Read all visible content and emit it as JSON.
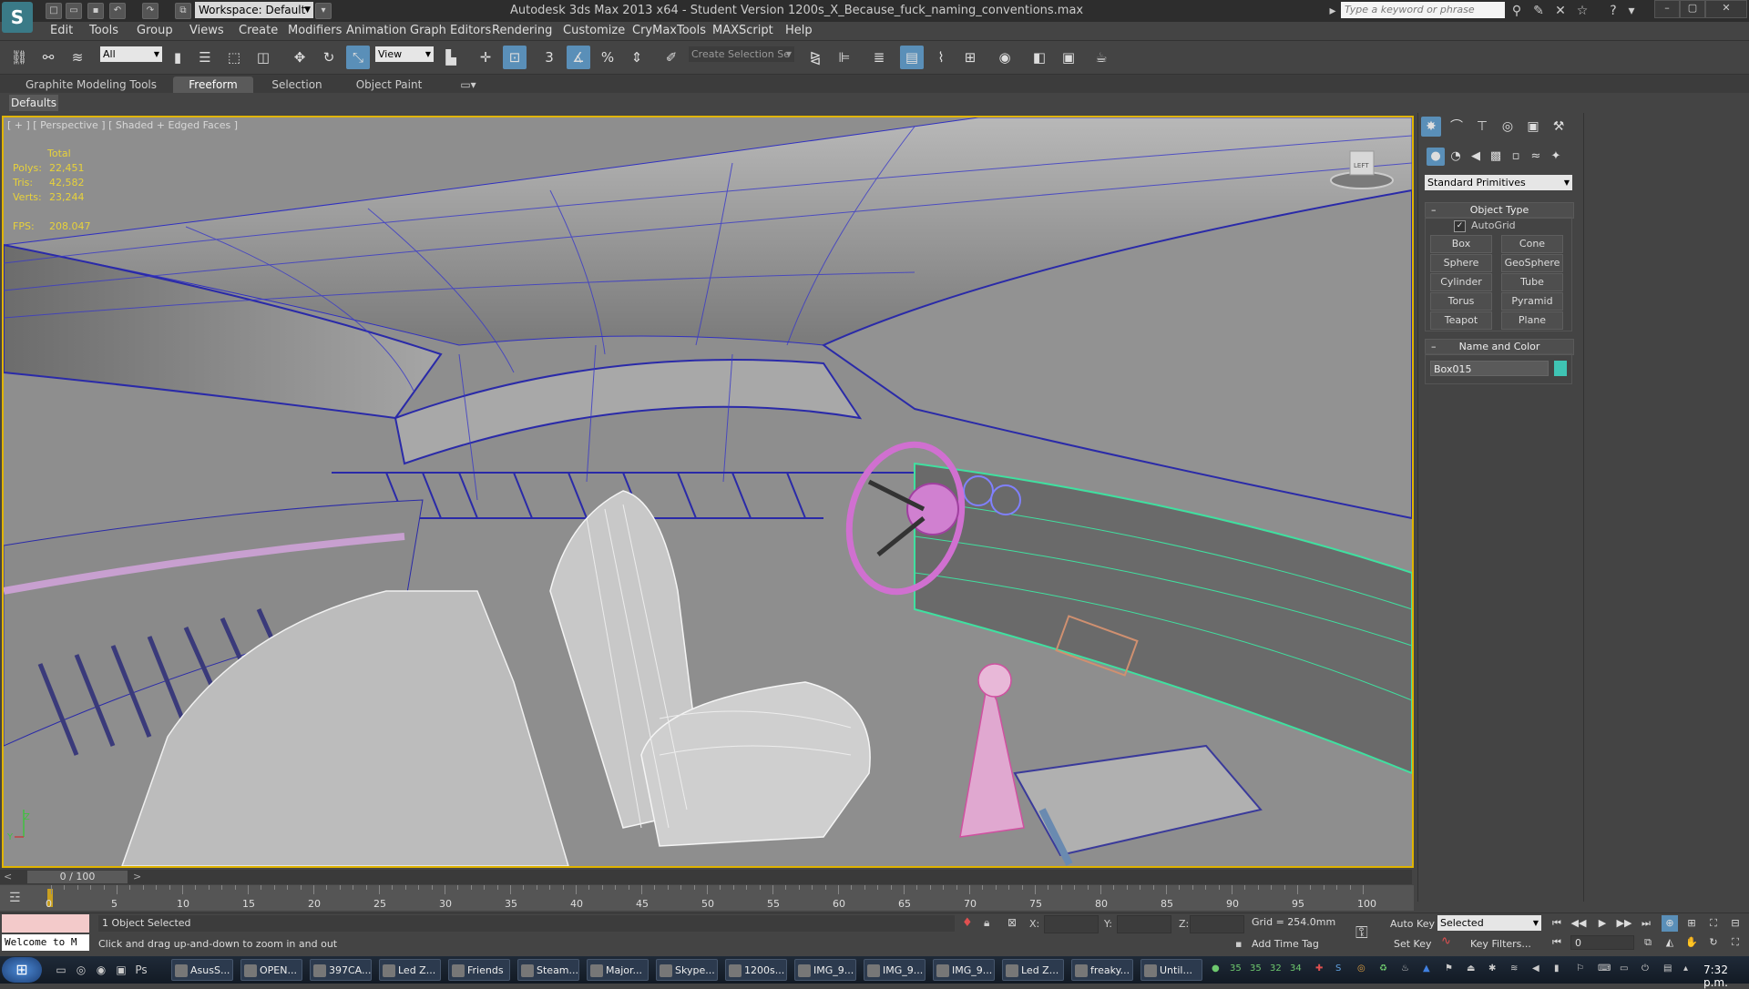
{
  "app": {
    "logo": "S",
    "workspace": "Workspace: Default",
    "title": "Autodesk 3ds Max  2013 x64   - Student Version    1200s_X_Because_fuck_naming_conventions.max",
    "search_placeholder": "Type a keyword or phrase"
  },
  "menu": [
    "Edit",
    "Tools",
    "Group",
    "Views",
    "Create",
    "Modifiers",
    "Animation",
    "Graph Editors",
    "Rendering",
    "Customize",
    "CryMaxTools",
    "MAXScript",
    "Help"
  ],
  "toolbar": {
    "filter_value": "All",
    "refcoord_value": "View",
    "snap_label": "3",
    "selection_set_placeholder": "Create Selection Se"
  },
  "ribbon": {
    "tabs": [
      "Graphite Modeling Tools",
      "Freeform",
      "Selection",
      "Object Paint"
    ],
    "active_tab": "Freeform",
    "defaults": "Defaults"
  },
  "viewport": {
    "label": "[ + ] [ Perspective ] [ Shaded + Edged Faces ]",
    "stats": {
      "header": "Total",
      "rows": [
        {
          "label": "Polys:",
          "value": "22,451"
        },
        {
          "label": "Tris:",
          "value": "42,582"
        },
        {
          "label": "Verts:",
          "value": "23,244"
        }
      ],
      "fps_label": "FPS:",
      "fps_value": "208.047"
    },
    "viewcube_label": "LEFT",
    "axis_y": "Y",
    "axis_z": "Z"
  },
  "command_panel": {
    "category_dropdown": "Standard Primitives",
    "object_type": {
      "title": "Object Type",
      "autogrid_label": "AutoGrid",
      "autogrid_checked": "✓",
      "buttons": [
        "Box",
        "Cone",
        "Sphere",
        "GeoSphere",
        "Cylinder",
        "Tube",
        "Torus",
        "Pyramid",
        "Teapot",
        "Plane"
      ]
    },
    "name_and_color": {
      "title": "Name and Color",
      "name": "Box015",
      "color": "#3fc4b4"
    }
  },
  "timeline": {
    "slider_label": "0 / 100",
    "ticks": [
      "0",
      "5",
      "10",
      "15",
      "20",
      "25",
      "30",
      "35",
      "40",
      "45",
      "50",
      "55",
      "60",
      "65",
      "70",
      "75",
      "80",
      "85",
      "90",
      "95",
      "100"
    ]
  },
  "status": {
    "listener_text": "Welcome to M",
    "selection": "1 Object Selected",
    "prompt": "Click and drag up-and-down to zoom in and out",
    "x_label": "X:",
    "y_label": "Y:",
    "z_label": "Z:",
    "grid": "Grid = 254.0mm",
    "add_time_tag": "Add Time Tag",
    "auto_key": "Auto Key",
    "set_key": "Set Key",
    "selected_dropdown": "Selected",
    "key_filters": "Key Filters...",
    "frame": "0"
  },
  "taskbar": {
    "tasks": [
      "AsusS...",
      "OPEN...",
      "397CA...",
      "Led Z...",
      "Friends",
      "Steam...",
      "Major...",
      "Skype...",
      "1200s...",
      "IMG_9...",
      "IMG_9...",
      "IMG_9...",
      "Led Z...",
      "freaky...",
      "Until..."
    ],
    "tray_numbers": [
      "35",
      "35",
      "32",
      "34"
    ],
    "clock": "7:32 p.m."
  },
  "colors": {
    "viewport_border": "#e0b400",
    "accent": "#5a8fb8",
    "stats_text": "#e8d23a"
  }
}
